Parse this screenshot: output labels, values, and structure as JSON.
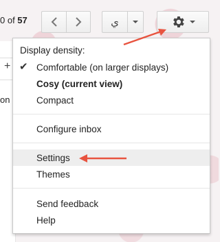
{
  "toolbar": {
    "count_prefix": "0 of ",
    "count_total": "57",
    "lang_glyph": "ي"
  },
  "left": {
    "plus": "+",
    "partial_text": "on #"
  },
  "menu": {
    "header": "Display density:",
    "items": [
      {
        "label": "Comfortable (on larger displays)"
      },
      {
        "label": "Cosy (current view)"
      },
      {
        "label": "Compact"
      },
      {
        "label": "Configure inbox"
      },
      {
        "label": "Settings"
      },
      {
        "label": "Themes"
      },
      {
        "label": "Send feedback"
      },
      {
        "label": "Help"
      }
    ]
  },
  "colors": {
    "annotation_arrow": "#e8533f",
    "hover_bg": "#eeeeee"
  }
}
